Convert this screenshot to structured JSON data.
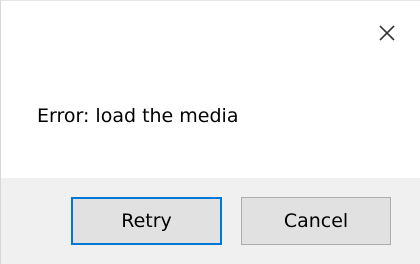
{
  "dialog": {
    "message": "Error: load the media",
    "close_icon": "close-icon",
    "buttons": {
      "retry_label": "Retry",
      "cancel_label": "Cancel"
    }
  },
  "colors": {
    "accent": "#0078d7",
    "footer_background": "#f0f0f0",
    "button_background": "#e1e1e1"
  }
}
